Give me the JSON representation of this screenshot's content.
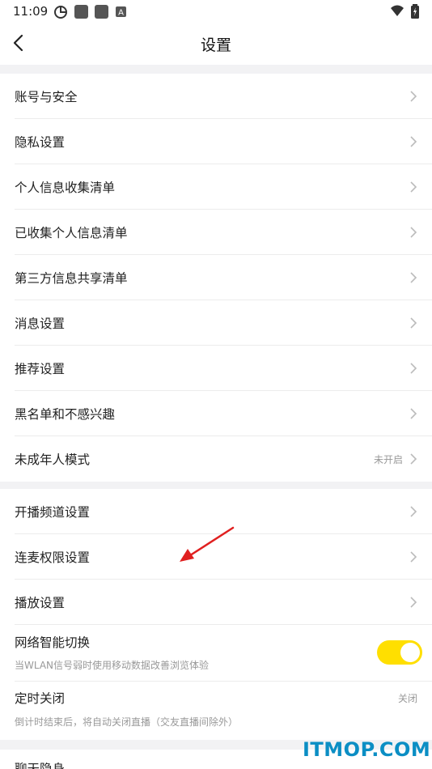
{
  "status_bar": {
    "time": "11:09"
  },
  "header": {
    "title": "设置"
  },
  "section1": [
    "账号与安全",
    "隐私设置",
    "个人信息收集清单",
    "已收集个人信息清单",
    "第三方信息共享清单",
    "消息设置",
    "推荐设置",
    "黑名单和不感兴趣"
  ],
  "minor_mode": {
    "label": "未成年人模式",
    "value": "未开启"
  },
  "section2": [
    "开播频道设置",
    "连麦权限设置",
    "播放设置"
  ],
  "network_switch": {
    "label": "网络智能切换",
    "sub": "当WLAN信号弱时使用移动数据改善浏览体验",
    "enabled": true
  },
  "timer": {
    "label": "定时关闭",
    "sub": "倒计时结束后，将自动关闭直播（交友直播间除外）",
    "value": "关闭"
  },
  "partial_item": "聊天隐身",
  "watermark": "ITMOP.COM"
}
